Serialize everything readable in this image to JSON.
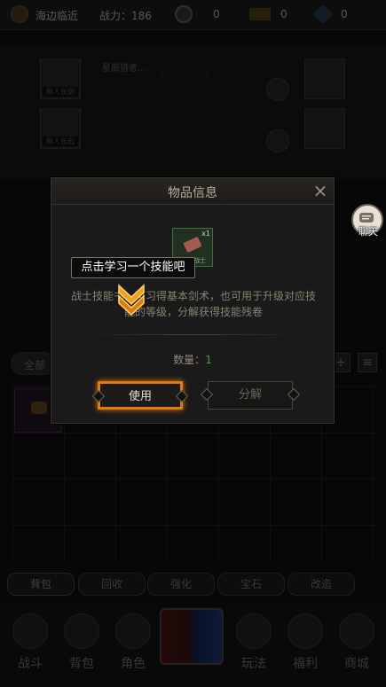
{
  "topbar": {
    "location": "海边临近",
    "power_label": "战力：186",
    "coin_value": "0",
    "gold_value": "0",
    "diamond_value": "0"
  },
  "hero": {
    "slot_left_top_label": "新人长剑",
    "slot_left_mid_label": "新人长石",
    "name": "星辰猎者..."
  },
  "chat": {
    "label": "聊天"
  },
  "modal": {
    "title": "物品信息",
    "close_glyph": "×",
    "item_qty": "x1",
    "item_name": "残卷·战士",
    "description": "战士技能书，可习得基本剑术，也可用于升级对应技能的等级，分解获得技能残卷",
    "quantity_label": "数量：",
    "quantity_value": "1",
    "use_label": "使用",
    "decompose_label": "分解"
  },
  "tutorial": {
    "hint": "点击学习一个技能吧"
  },
  "filter": {
    "all_label": "全部",
    "plus": "+",
    "list": "≡"
  },
  "bag_tabs": [
    "背包",
    "回收",
    "强化",
    "宝石",
    "改造"
  ],
  "nav": [
    {
      "label": "战斗",
      "icon": "crossed-swords-icon"
    },
    {
      "label": "背包",
      "icon": "backpack-icon"
    },
    {
      "label": "角色",
      "icon": "helmet-icon"
    },
    {
      "label": "玩法",
      "icon": "slash-icon"
    },
    {
      "label": "福利",
      "icon": "chest-icon"
    },
    {
      "label": "商城",
      "icon": "shop-icon"
    }
  ],
  "colors": {
    "accent_orange": "#e07c0e",
    "quantity_green": "#4f9a3e",
    "hint_white": "#ffffff"
  }
}
